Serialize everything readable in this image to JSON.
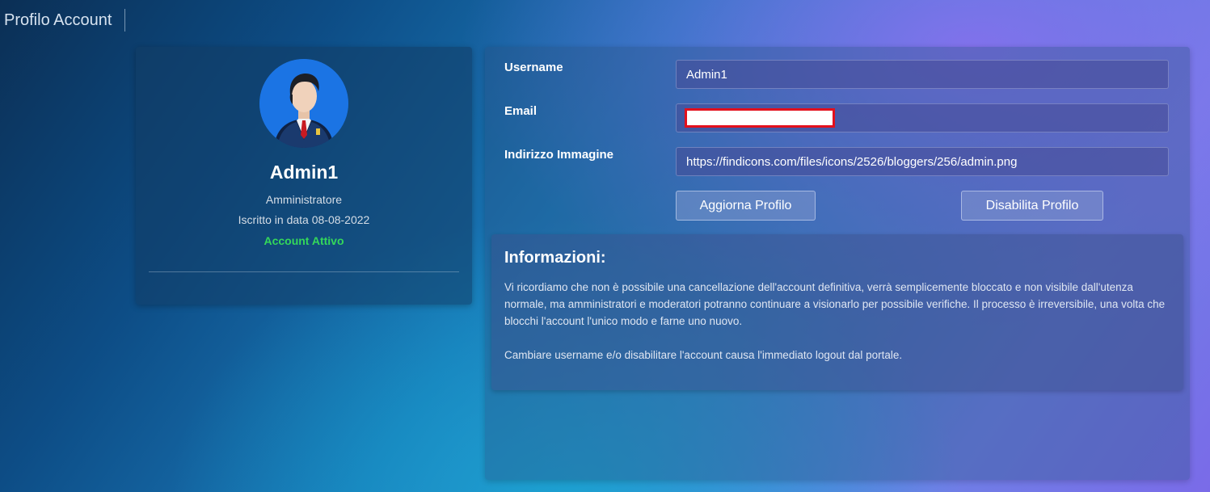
{
  "header": {
    "title": "Profilo Account"
  },
  "profile": {
    "name": "Admin1",
    "role": "Amministratore",
    "joined": "Iscritto in data 08-08-2022",
    "status": "Account Attivo",
    "status_color": "#34d85a",
    "avatar_icon": "businessman-avatar-icon"
  },
  "form": {
    "username_label": "Username",
    "username_value": "Admin1",
    "email_label": "Email",
    "email_value": "",
    "image_label": "Indirizzo Immagine",
    "image_value": "https://findicons.com/files/icons/2526/bloggers/256/admin.png",
    "update_button": "Aggiorna Profilo",
    "disable_button": "Disabilita Profilo"
  },
  "info": {
    "title": "Informazioni:",
    "paragraph1": "Vi ricordiamo che non è possibile una cancellazione dell'account definitiva, verrà semplicemente bloccato e non visibile dall'utenza normale, ma amministratori e moderatori potranno continuare a visionarlo per possibile verifiche. Il processo è irreversibile, una volta che blocchi l'account l'unico modo e farne uno nuovo.",
    "paragraph2": "Cambiare username e/o disabilitare l'account causa l'immediato logout dal portale."
  }
}
